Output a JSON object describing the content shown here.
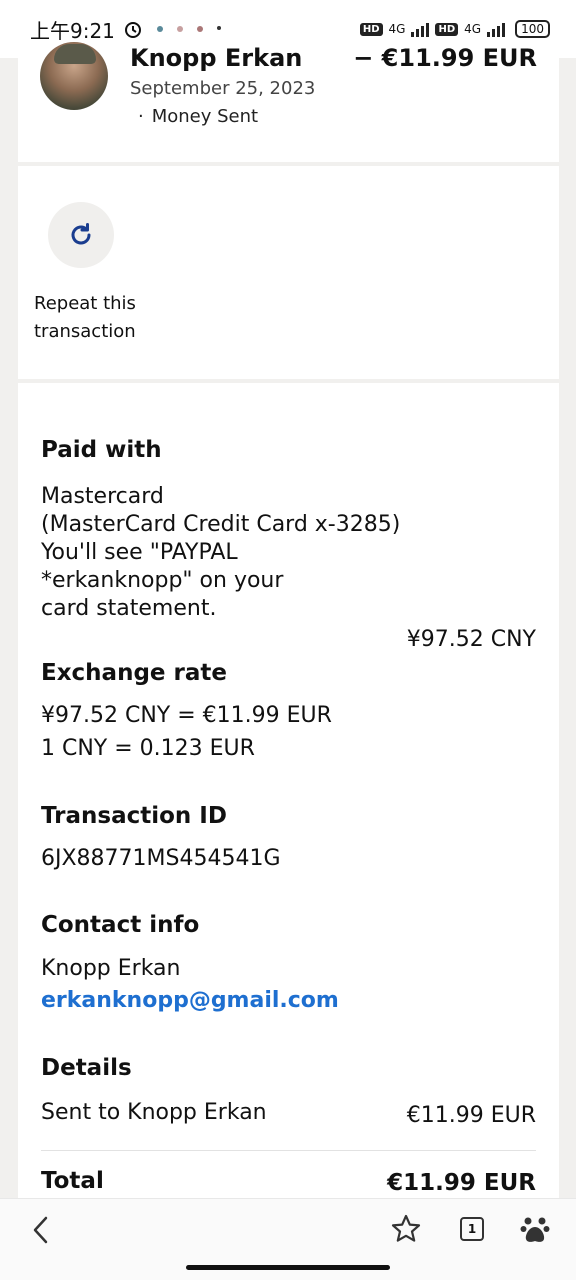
{
  "status_bar": {
    "time": "上午9:21",
    "battery": "100",
    "network_1": "4G",
    "network_2": "4G",
    "hd": "HD"
  },
  "header": {
    "name": "Knopp Erkan",
    "date": "September 25, 2023",
    "bullet": "·",
    "kind": "Money Sent",
    "amount": "− €11.99 EUR"
  },
  "repeat": {
    "label": "Repeat this transaction"
  },
  "paid_with": {
    "heading": "Paid with",
    "line1": "Mastercard",
    "line2": "(MasterCard Credit Card x-3285)",
    "line3": "You'll see \"PAYPAL",
    "line4": "*erkanknopp\" on your",
    "line5": "card statement.",
    "amount": "¥97.52 CNY"
  },
  "exchange": {
    "heading": "Exchange rate",
    "line1": "¥97.52 CNY = €11.99 EUR",
    "line2": "1 CNY = 0.123 EUR"
  },
  "transaction": {
    "heading": "Transaction ID",
    "id": "6JX88771MS454541G"
  },
  "contact": {
    "heading": "Contact info",
    "name": "Knopp Erkan",
    "email": "erkanknopp@gmail.com"
  },
  "details": {
    "heading": "Details",
    "sent_label": "Sent to Knopp Erkan",
    "sent_amount": "€11.99 EUR"
  },
  "total": {
    "label": "Total",
    "amount": "€11.99 EUR"
  },
  "nav": {
    "tab_count": "1",
    "back_icon": "chevron-left-icon",
    "star_icon": "star-icon",
    "tabs_icon": "tabs-icon",
    "paw_icon": "baidu-paw-icon"
  },
  "colors": {
    "link": "#1e6fd0",
    "repeat_icon": "#1a3d8f"
  }
}
